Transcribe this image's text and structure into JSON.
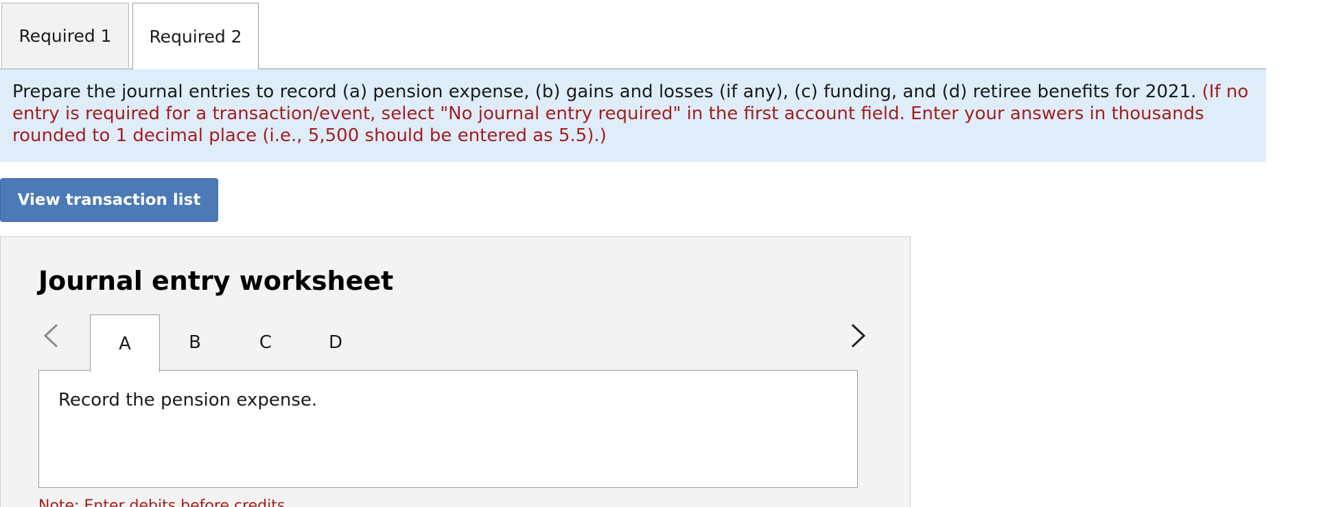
{
  "top_tabs": [
    {
      "label": "Required 1",
      "active": false
    },
    {
      "label": "Required 2",
      "active": true
    }
  ],
  "instruction": {
    "main": "Prepare the journal entries to record (a) pension expense, (b) gains and losses (if any), (c) funding, and (d) retiree benefits for 2021.",
    "note": "(If no entry is required for a transaction/event, select \"No journal entry required\" in the first account field. Enter your answers in thousands rounded to 1 decimal place (i.e., 5,500 should be entered as 5.5).)"
  },
  "view_button": {
    "label": "View transaction list"
  },
  "worksheet": {
    "title": "Journal entry worksheet",
    "tabs": [
      {
        "label": "A",
        "active": true
      },
      {
        "label": "B",
        "active": false
      },
      {
        "label": "C",
        "active": false
      },
      {
        "label": "D",
        "active": false
      }
    ],
    "content": "Record the pension expense.",
    "note": "Note: Enter debits before credits."
  },
  "colors": {
    "instruction_bg": "#deedf9",
    "note_red": "#a51d1d",
    "button_blue": "#4b7ab7",
    "panel_bg": "#f3f3f3"
  },
  "icons": {
    "prev": "chevron-left-icon",
    "next": "chevron-right-icon"
  }
}
